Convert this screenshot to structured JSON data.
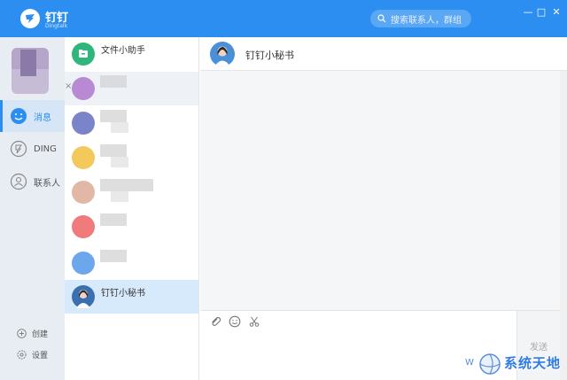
{
  "window": {
    "title": "钉钉",
    "subtitle": "Dingtalk",
    "search_placeholder": "搜索联系人，群组",
    "minimize": "—",
    "maximize": "□",
    "close": "✕"
  },
  "nav": {
    "items": [
      {
        "label": "消息",
        "icon": "smile-icon",
        "active": true
      },
      {
        "label": "DING",
        "icon": "ding-icon",
        "active": false
      },
      {
        "label": "联系人",
        "icon": "contact-icon",
        "active": false
      }
    ],
    "bottom": [
      {
        "label": "创建",
        "icon": "plus-circle-icon"
      },
      {
        "label": "设置",
        "icon": "gear-icon"
      }
    ]
  },
  "conversations": [
    {
      "name": "文件小助手",
      "color": "#2fb67a"
    },
    {
      "name": "",
      "color": "#b88ad4",
      "close_mark": "×"
    },
    {
      "name": "",
      "color": "#7c84c9"
    },
    {
      "name": "",
      "color": "#f2c95a"
    },
    {
      "name": "",
      "color": "#e3b7a6"
    },
    {
      "name": "",
      "color": "#ef7b7b"
    },
    {
      "name": "",
      "color": "#6ba7ea"
    },
    {
      "name": "钉钉小秘书",
      "color": "#3b6fb0"
    }
  ],
  "chat": {
    "title": "钉钉小秘书",
    "send_label": "发送",
    "tools": [
      "attach-icon",
      "emoji-icon",
      "scissors-icon"
    ]
  },
  "watermark": {
    "prefix": "W",
    "text": "系统天地"
  },
  "colors": {
    "accent": "#2b8ef0"
  }
}
